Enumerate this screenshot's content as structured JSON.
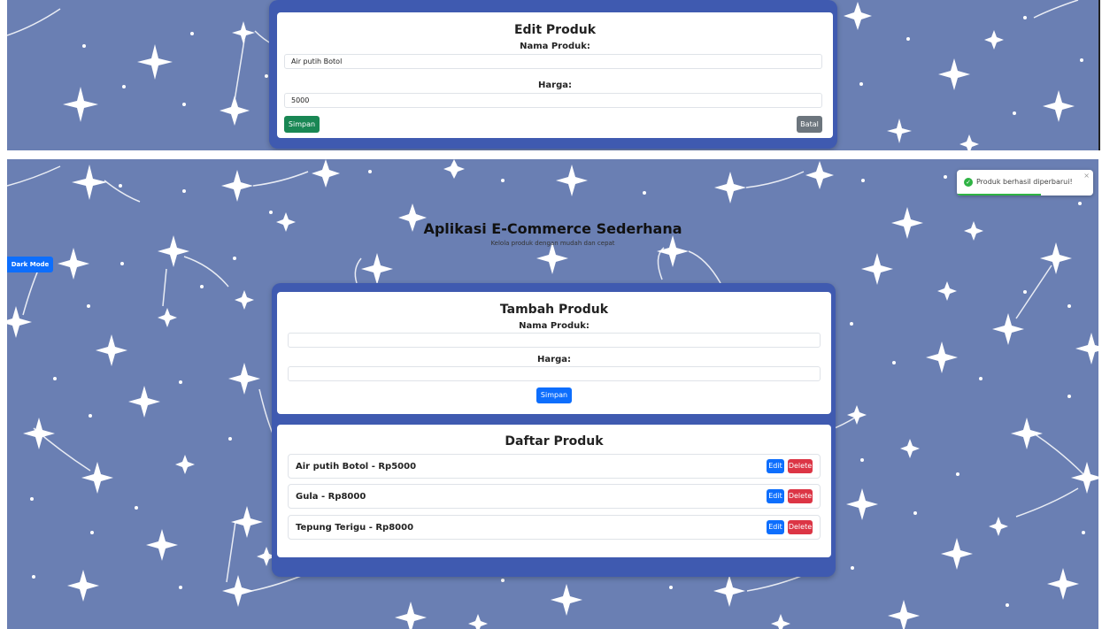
{
  "edit_form": {
    "title": "Edit Produk",
    "name_label": "Nama Produk:",
    "name_value": "Air putih Botol",
    "price_label": "Harga:",
    "price_value": "5000",
    "save_label": "Simpan",
    "cancel_label": "Batal"
  },
  "header": {
    "title": "Aplikasi E-Commerce Sederhana",
    "subtitle": "Kelola produk dengan mudah dan cepat"
  },
  "dark_mode_label": "Dark Mode",
  "add_form": {
    "title": "Tambah Produk",
    "name_label": "Nama Produk:",
    "name_value": "",
    "price_label": "Harga:",
    "price_value": "",
    "save_label": "Simpan"
  },
  "product_list": {
    "title": "Daftar Produk",
    "edit_label": "Edit",
    "delete_label": "Delete",
    "items": [
      {
        "text": "Air putih Botol - Rp5000"
      },
      {
        "text": "Gula - Rp8000"
      },
      {
        "text": "Tepung Terigu - Rp8000"
      }
    ]
  },
  "toast": {
    "message": "Produk berhasil diperbarui!",
    "close": "×",
    "icon": "check-circle-icon",
    "progress": 0.62
  },
  "colors": {
    "background": "#6a7fb3",
    "frame": "#3f5ab0",
    "primary": "#0d6efd",
    "success": "#198754",
    "danger": "#dc3545",
    "secondary": "#6c757d"
  }
}
